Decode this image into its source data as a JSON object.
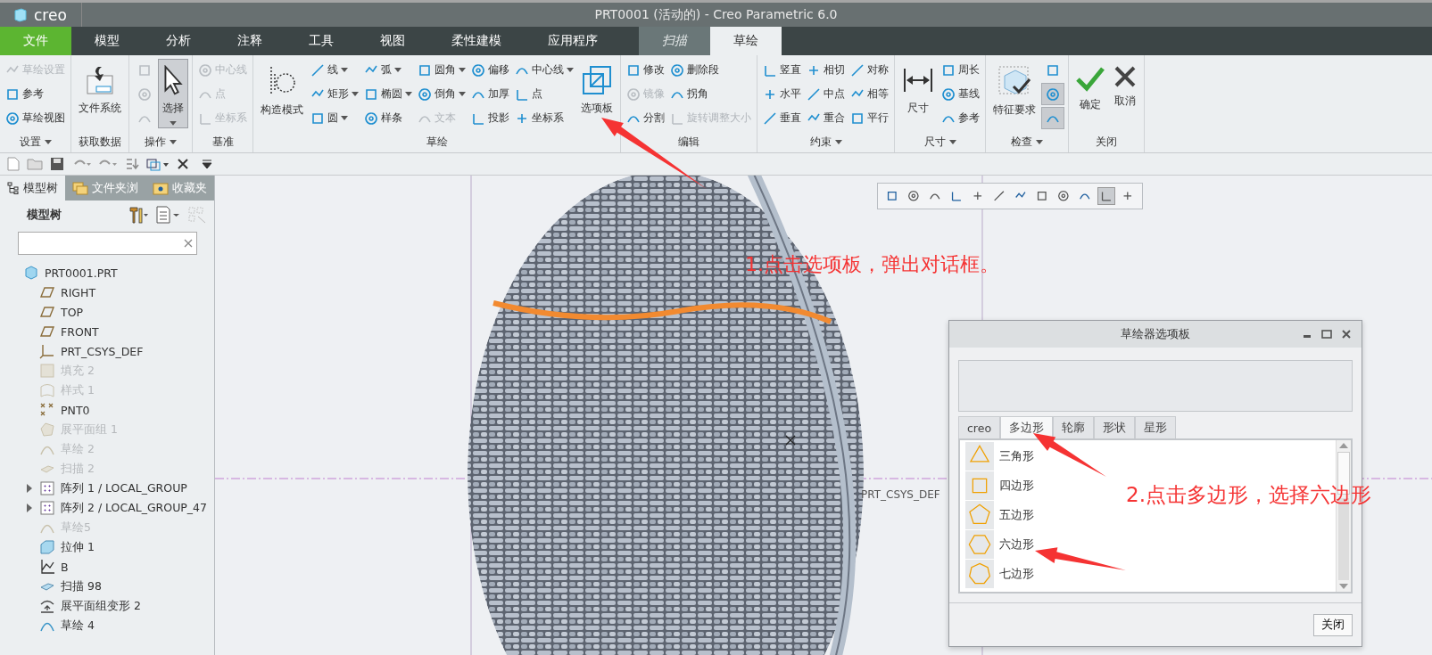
{
  "app": {
    "logo": "creo",
    "title": "PRT0001 (活动的) - Creo Parametric 6.0"
  },
  "menu_tabs": [
    {
      "label": "文件",
      "kind": "file",
      "selected": false
    },
    {
      "label": "模型",
      "kind": "normal",
      "selected": false
    },
    {
      "label": "分析",
      "kind": "normal",
      "selected": false
    },
    {
      "label": "注释",
      "kind": "normal",
      "selected": false
    },
    {
      "label": "工具",
      "kind": "normal",
      "selected": false
    },
    {
      "label": "视图",
      "kind": "normal",
      "selected": false
    },
    {
      "label": "柔性建模",
      "kind": "normal",
      "selected": false
    },
    {
      "label": "应用程序",
      "kind": "normal",
      "selected": false
    },
    {
      "label": "扫描",
      "kind": "context",
      "selected": false
    },
    {
      "label": "草绘",
      "kind": "normal",
      "selected": true
    }
  ],
  "ribbon_groups": [
    {
      "label": "设置",
      "dropdown": true,
      "columns": [
        [
          {
            "kind": "small",
            "label": "草绘设置",
            "disabled": true,
            "dropdown": false
          },
          {
            "kind": "small",
            "label": "参考",
            "disabled": false,
            "dropdown": false
          },
          {
            "kind": "small",
            "label": "草绘视图",
            "disabled": false,
            "dropdown": false
          }
        ]
      ]
    },
    {
      "label": "获取数据",
      "dropdown": false,
      "columns": [
        [
          {
            "kind": "large",
            "label": "文件系统",
            "disabled": false,
            "dropdown": false,
            "pressed": false
          }
        ]
      ]
    },
    {
      "label": "操作",
      "dropdown": true,
      "columns": [
        [
          {
            "kind": "icon",
            "disabled": true
          },
          {
            "kind": "icon",
            "disabled": true
          },
          {
            "kind": "icon",
            "disabled": true
          }
        ],
        [
          {
            "kind": "large",
            "label": "选择",
            "disabled": false,
            "dropdown": true,
            "pressed": true
          }
        ]
      ]
    },
    {
      "label": "基准",
      "dropdown": false,
      "columns": [
        [
          {
            "kind": "small",
            "label": "中心线",
            "disabled": true,
            "dropdown": false
          },
          {
            "kind": "small",
            "label": "点",
            "disabled": true,
            "dropdown": false
          },
          {
            "kind": "small",
            "label": "坐标系",
            "disabled": true,
            "dropdown": false
          }
        ]
      ]
    },
    {
      "label": "草绘",
      "dropdown": false,
      "columns": [
        [
          {
            "kind": "large",
            "label": "构造模式",
            "disabled": false,
            "dropdown": false,
            "pressed": false
          }
        ],
        [
          {
            "kind": "small",
            "label": "线",
            "disabled": false,
            "dropdown": true
          },
          {
            "kind": "small",
            "label": "矩形",
            "disabled": false,
            "dropdown": true
          },
          {
            "kind": "small",
            "label": "圆",
            "disabled": false,
            "dropdown": true
          }
        ],
        [
          {
            "kind": "small",
            "label": "弧",
            "disabled": false,
            "dropdown": true
          },
          {
            "kind": "small",
            "label": "椭圆",
            "disabled": false,
            "dropdown": true
          },
          {
            "kind": "small",
            "label": "样条",
            "disabled": false,
            "dropdown": false
          }
        ],
        [
          {
            "kind": "small",
            "label": "圆角",
            "disabled": false,
            "dropdown": true
          },
          {
            "kind": "small",
            "label": "倒角",
            "disabled": false,
            "dropdown": true
          },
          {
            "kind": "small",
            "label": "文本",
            "disabled": true,
            "dropdown": false
          }
        ],
        [
          {
            "kind": "small",
            "label": "偏移",
            "disabled": false,
            "dropdown": false
          },
          {
            "kind": "small",
            "label": "加厚",
            "disabled": false,
            "dropdown": false
          },
          {
            "kind": "small",
            "label": "投影",
            "disabled": false,
            "dropdown": false
          }
        ],
        [
          {
            "kind": "small",
            "label": "中心线",
            "disabled": false,
            "dropdown": true
          },
          {
            "kind": "small",
            "label": "点",
            "disabled": false,
            "dropdown": false
          },
          {
            "kind": "small",
            "label": "坐标系",
            "disabled": false,
            "dropdown": false
          }
        ],
        [
          {
            "kind": "large",
            "label": "选项板",
            "disabled": false,
            "dropdown": false,
            "pressed": false
          }
        ]
      ]
    },
    {
      "label": "编辑",
      "dropdown": false,
      "columns": [
        [
          {
            "kind": "small",
            "label": "修改",
            "disabled": false,
            "dropdown": false
          },
          {
            "kind": "small",
            "label": "镜像",
            "disabled": true,
            "dropdown": false
          },
          {
            "kind": "small",
            "label": "分割",
            "disabled": false,
            "dropdown": false
          }
        ],
        [
          {
            "kind": "small",
            "label": "删除段",
            "disabled": false,
            "dropdown": false
          },
          {
            "kind": "small",
            "label": "拐角",
            "disabled": false,
            "dropdown": false
          },
          {
            "kind": "small",
            "label": "旋转调整大小",
            "disabled": true,
            "dropdown": false
          }
        ]
      ]
    },
    {
      "label": "约束",
      "dropdown": true,
      "columns": [
        [
          {
            "kind": "small",
            "label": "竖直",
            "disabled": false,
            "dropdown": false
          },
          {
            "kind": "small",
            "label": "水平",
            "disabled": false,
            "dropdown": false
          },
          {
            "kind": "small",
            "label": "垂直",
            "disabled": false,
            "dropdown": false
          }
        ],
        [
          {
            "kind": "small",
            "label": "相切",
            "disabled": false,
            "dropdown": false
          },
          {
            "kind": "small",
            "label": "中点",
            "disabled": false,
            "dropdown": false
          },
          {
            "kind": "small",
            "label": "重合",
            "disabled": false,
            "dropdown": false
          }
        ],
        [
          {
            "kind": "small",
            "label": "对称",
            "disabled": false,
            "dropdown": false
          },
          {
            "kind": "small",
            "label": "相等",
            "disabled": false,
            "dropdown": false
          },
          {
            "kind": "small",
            "label": "平行",
            "disabled": false,
            "dropdown": false
          }
        ]
      ]
    },
    {
      "label": "尺寸",
      "dropdown": true,
      "columns": [
        [
          {
            "kind": "large",
            "label": "尺寸",
            "disabled": false,
            "dropdown": false,
            "pressed": false
          }
        ],
        [
          {
            "kind": "small",
            "label": "周长",
            "disabled": false,
            "dropdown": false
          },
          {
            "kind": "small",
            "label": "基线",
            "disabled": false,
            "dropdown": false
          },
          {
            "kind": "small",
            "label": "参考",
            "disabled": false,
            "dropdown": false
          }
        ]
      ]
    },
    {
      "label": "检查",
      "dropdown": true,
      "columns": [
        [
          {
            "kind": "large",
            "label": "特征要求",
            "disabled": false,
            "dropdown": false,
            "pressed": false
          }
        ],
        [
          {
            "kind": "icon",
            "disabled": false,
            "pressed": false
          },
          {
            "kind": "icon",
            "disabled": false,
            "pressed": true
          },
          {
            "kind": "icon",
            "disabled": false,
            "pressed": true
          }
        ]
      ]
    },
    {
      "label": "关闭",
      "dropdown": false,
      "columns": [
        [
          {
            "kind": "large",
            "label": "确定",
            "disabled": false,
            "dropdown": false,
            "pressed": false
          }
        ],
        [
          {
            "kind": "large",
            "label": "取消",
            "disabled": false,
            "dropdown": false,
            "pressed": false
          }
        ]
      ]
    }
  ],
  "left_panel": {
    "tabs": [
      {
        "label": "模型树",
        "selected": true
      },
      {
        "label": "文件夹浏",
        "selected": false
      },
      {
        "label": "收藏夹",
        "selected": false
      }
    ],
    "header": "模型树",
    "tree": [
      {
        "label": "PRT0001.PRT",
        "kind": "part",
        "disabled": false,
        "children": [
          {
            "label": "RIGHT",
            "kind": "plane",
            "disabled": false
          },
          {
            "label": "TOP",
            "kind": "plane",
            "disabled": false
          },
          {
            "label": "FRONT",
            "kind": "plane",
            "disabled": false
          },
          {
            "label": "PRT_CSYS_DEF",
            "kind": "csys",
            "disabled": false
          },
          {
            "label": "填充 2",
            "kind": "fill",
            "disabled": true
          },
          {
            "label": "样式 1",
            "kind": "style",
            "disabled": true
          },
          {
            "label": "PNT0",
            "kind": "point",
            "disabled": false
          },
          {
            "label": "展平面组 1",
            "kind": "flatten",
            "disabled": true
          },
          {
            "label": "草绘 2",
            "kind": "sketch",
            "disabled": true
          },
          {
            "label": "扫描 2",
            "kind": "sweep",
            "disabled": true
          },
          {
            "label": "阵列 1 / LOCAL_GROUP",
            "kind": "pattern",
            "disabled": false,
            "expanded": false
          },
          {
            "label": "阵列 2 / LOCAL_GROUP_47",
            "kind": "pattern",
            "disabled": false,
            "expanded": false
          },
          {
            "label": "草绘5",
            "kind": "sketch",
            "disabled": true
          },
          {
            "label": "拉伸 1",
            "kind": "extrude",
            "disabled": false
          },
          {
            "label": "B",
            "kind": "graph",
            "disabled": false
          },
          {
            "label": "扫描 98",
            "kind": "sweep",
            "disabled": false
          },
          {
            "label": "展平面组变形 2",
            "kind": "warp",
            "disabled": false
          },
          {
            "label": "草绘 4",
            "kind": "sketch",
            "disabled": false
          }
        ]
      }
    ]
  },
  "viewport": {
    "csys_label": "PRT_CSYS_DEF"
  },
  "dialog": {
    "title": "草绘器选项板",
    "tabs": [
      {
        "label": "creo",
        "selected": false
      },
      {
        "label": "多边形",
        "selected": true
      },
      {
        "label": "轮廓",
        "selected": false
      },
      {
        "label": "形状",
        "selected": false
      },
      {
        "label": "星形",
        "selected": false
      }
    ],
    "shapes": [
      {
        "label": "三角形",
        "kind": "triangle"
      },
      {
        "label": "四边形",
        "kind": "square"
      },
      {
        "label": "五边形",
        "kind": "pentagon"
      },
      {
        "label": "六边形",
        "kind": "hexagon"
      },
      {
        "label": "七边形",
        "kind": "heptagon"
      }
    ],
    "close_button": "关闭"
  },
  "annotations": [
    {
      "text": "1.点击选项板，弹出对话框。"
    },
    {
      "text": "2.点击多边形，选择六边形"
    }
  ]
}
